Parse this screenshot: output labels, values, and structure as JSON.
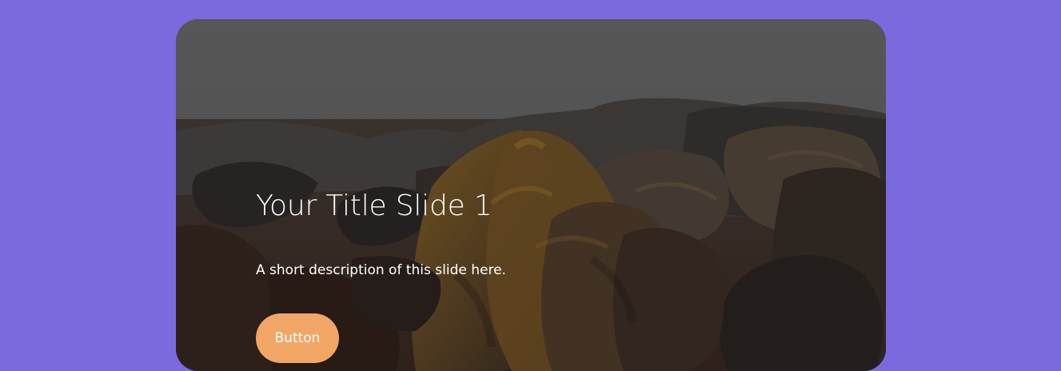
{
  "colors": {
    "page_background": "#7b6ade",
    "button_background": "#f2a666",
    "text": "#ffffff"
  },
  "slide": {
    "title": "Your Title Slide 1",
    "description": "A short description of this slide here.",
    "button_label": "Button"
  }
}
